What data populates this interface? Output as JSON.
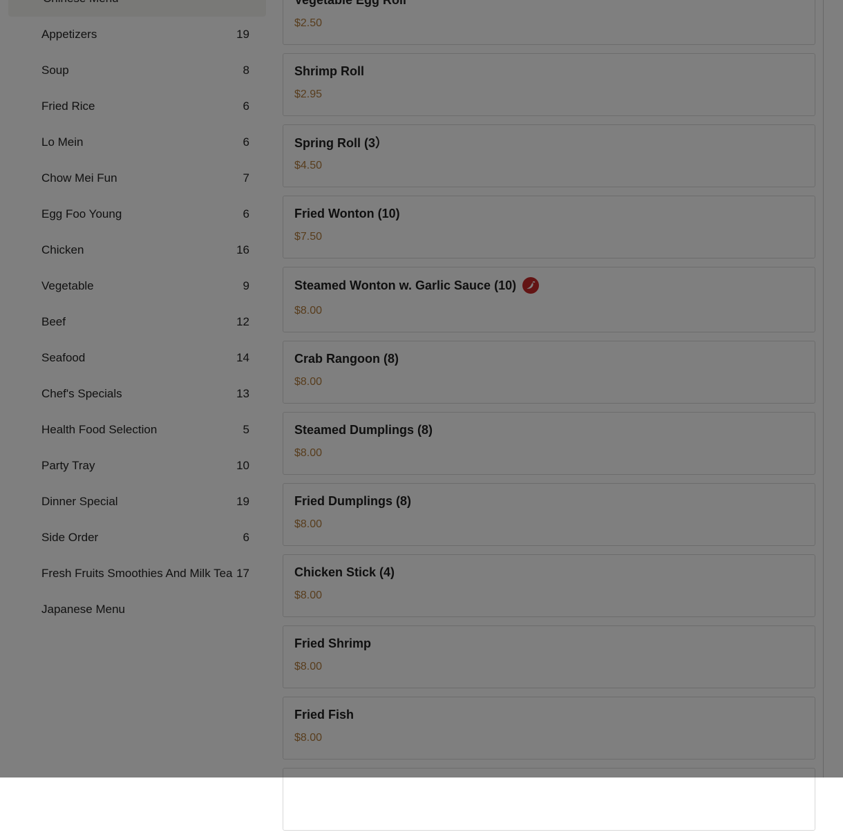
{
  "sidebar": {
    "header": "Chinese Menu",
    "items": [
      {
        "label": "Appetizers",
        "count": "19"
      },
      {
        "label": "Soup",
        "count": "8"
      },
      {
        "label": "Fried Rice",
        "count": "6"
      },
      {
        "label": "Lo Mein",
        "count": "6"
      },
      {
        "label": "Chow Mei Fun",
        "count": "7"
      },
      {
        "label": "Egg Foo Young",
        "count": "6"
      },
      {
        "label": "Chicken",
        "count": "16"
      },
      {
        "label": "Vegetable",
        "count": "9"
      },
      {
        "label": "Beef",
        "count": "12"
      },
      {
        "label": "Seafood",
        "count": "14"
      },
      {
        "label": "Chef's Specials",
        "count": "13"
      },
      {
        "label": "Health Food Selection",
        "count": "5"
      },
      {
        "label": "Party Tray",
        "count": "10"
      },
      {
        "label": "Dinner Special",
        "count": "19"
      },
      {
        "label": "Side Order",
        "count": "6"
      },
      {
        "label": "Fresh Fruits Smoothies And Milk Tea",
        "count": "17"
      },
      {
        "label": "Japanese Menu",
        "count": ""
      }
    ]
  },
  "menu": {
    "items": [
      {
        "name": "Vegetable Egg Roll",
        "price": "$2.50"
      },
      {
        "name": "Shrimp Roll",
        "price": "$2.95"
      },
      {
        "name": "Spring Roll (3）",
        "price": "$4.50"
      },
      {
        "name": "Fried Wonton (10)",
        "price": "$7.50"
      },
      {
        "name": "Steamed Wonton w. Garlic Sauce (10)",
        "price": "$8.00",
        "spicy": true
      },
      {
        "name": "Crab Rangoon (8)",
        "price": "$8.00"
      },
      {
        "name": "Steamed Dumplings (8)",
        "price": "$8.00"
      },
      {
        "name": "Fried Dumplings (8)",
        "price": "$8.00"
      },
      {
        "name": "Chicken Stick (4)",
        "price": "$8.00"
      },
      {
        "name": "Fried Shrimp",
        "price": "$8.00"
      },
      {
        "name": "Fried Fish",
        "price": "$8.00"
      },
      {
        "name": "",
        "price": ""
      }
    ]
  },
  "colors": {
    "price": "#b07a3a",
    "spicy_badge": "#c62828",
    "overlay": "rgba(0,0,0,0.5)"
  },
  "icons": {
    "spicy": "chili-pepper-icon"
  }
}
